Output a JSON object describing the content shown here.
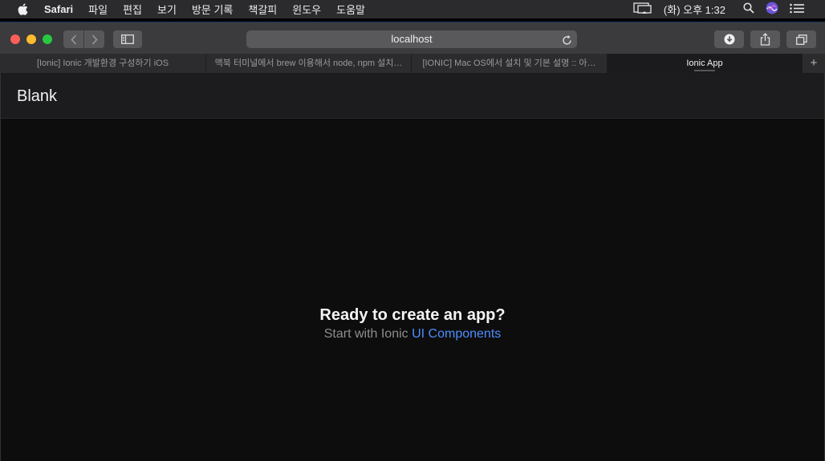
{
  "menubar": {
    "app_name": "Safari",
    "items": [
      "파일",
      "편집",
      "보기",
      "방문 기록",
      "책갈피",
      "윈도우",
      "도움말"
    ],
    "clock": "(화) 오후 1:32"
  },
  "toolbar": {
    "url": "localhost"
  },
  "tabs": [
    {
      "title": "[Ionic] Ionic 개발환경 구성하기 iOS"
    },
    {
      "title": "맥북 터미널에서 brew 이용해서 node, npm 설치…"
    },
    {
      "title": "[IONIC] Mac OS에서 설치 및 기본 설명 :: 아…"
    },
    {
      "title": "Ionic App"
    }
  ],
  "new_tab_label": "+",
  "page": {
    "header_title": "Blank",
    "heading": "Ready to create an app?",
    "sub_prefix": "Start with Ionic ",
    "link": "UI Components"
  },
  "colors": {
    "accent": "#4d8dff",
    "close": "#fc5f57",
    "minimize": "#fdbc2e",
    "zoom": "#28c840"
  }
}
